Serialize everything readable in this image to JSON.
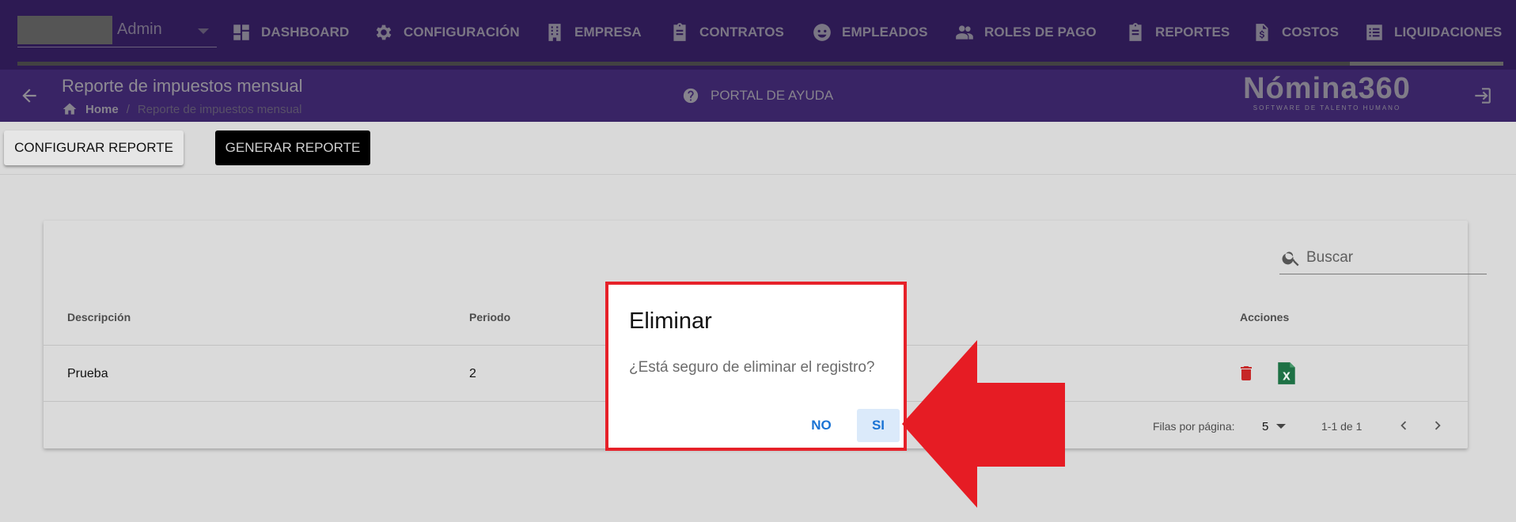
{
  "user": {
    "name": "Admin"
  },
  "nav": {
    "items": [
      {
        "label": "DASHBOARD",
        "icon": "dashboard-icon"
      },
      {
        "label": "CONFIGURACIÓN",
        "icon": "gear-icon"
      },
      {
        "label": "EMPRESA",
        "icon": "building-icon"
      },
      {
        "label": "CONTRATOS",
        "icon": "clipboard-icon"
      },
      {
        "label": "EMPLEADOS",
        "icon": "face-icon"
      },
      {
        "label": "ROLES DE PAGO",
        "icon": "people-icon"
      },
      {
        "label": "REPORTES",
        "icon": "clipboard-icon"
      },
      {
        "label": "COSTOS",
        "icon": "invoice-icon"
      },
      {
        "label": "LIQUIDACIONES",
        "icon": "list-icon"
      }
    ],
    "active": "LIQUIDACIONES"
  },
  "header": {
    "title": "Reporte de impuestos mensual",
    "breadcrumb": {
      "home": "Home",
      "separator": "/",
      "current": "Reporte de impuestos mensual"
    },
    "help": "PORTAL DE AYUDA",
    "brand_name": "Nómina360",
    "brand_tagline": "SOFTWARE DE TALENTO HUMANO"
  },
  "toolbar": {
    "configure_label": "CONFIGURAR REPORTE",
    "generate_label": "GENERAR REPORTE"
  },
  "table": {
    "search_placeholder": "Buscar",
    "columns": {
      "descripcion": "Descripción",
      "periodo": "Periodo",
      "acciones": "Acciones"
    },
    "rows": [
      {
        "descripcion": "Prueba",
        "periodo": "2"
      }
    ],
    "pagination": {
      "rows_per_page_label": "Filas por página:",
      "rows_per_page": "5",
      "range": "1-1 de 1"
    }
  },
  "dialog": {
    "title": "Eliminar",
    "message": "¿Está seguro de eliminar el registro?",
    "no_label": "NO",
    "yes_label": "SI"
  },
  "colors": {
    "nav_bg": "#4a2a86",
    "header_bg": "#5d3aa3",
    "accent_blue": "#1a73d4",
    "delete_red": "#c62828",
    "excel_green": "#1e7145",
    "highlight_red": "#e62129"
  }
}
